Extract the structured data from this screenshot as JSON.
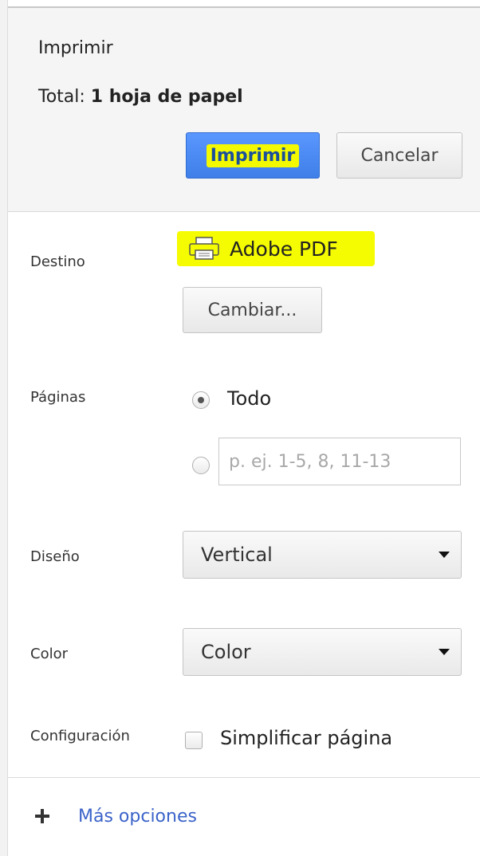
{
  "header": {
    "title": "Imprimir",
    "total_prefix": "Total:",
    "total_value": "1 hoja de papel",
    "print_button": "Imprimir",
    "cancel_button": "Cancelar"
  },
  "destination": {
    "label": "Destino",
    "printer_icon": "printer-icon",
    "name": "Adobe PDF",
    "change_button": "Cambiar..."
  },
  "pages": {
    "label": "Páginas",
    "option_all": "Todo",
    "option_all_checked": true,
    "custom_placeholder": "p. ej. 1-5, 8, 11-13"
  },
  "layout": {
    "label": "Diseño",
    "selected": "Vertical"
  },
  "color": {
    "label": "Color",
    "selected": "Color"
  },
  "settings": {
    "label": "Configuración",
    "simplify_label": "Simplificar página",
    "simplify_checked": false
  },
  "more": {
    "icon": "plus-icon",
    "link": "Más opciones"
  },
  "colors": {
    "print_button": "#4a8af4",
    "highlight": "#f5fb00",
    "link": "#3b63c9"
  }
}
